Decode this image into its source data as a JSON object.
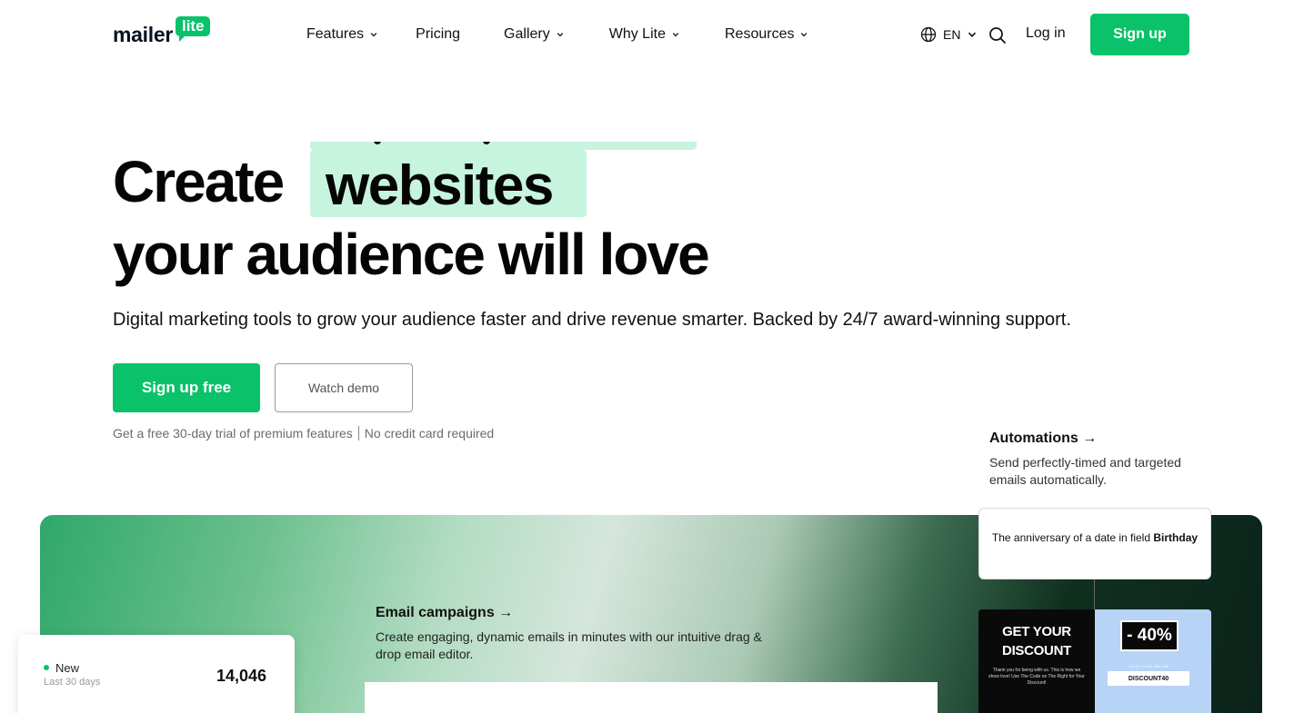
{
  "brand": {
    "word": "mailer",
    "badge": "lite",
    "accent": "#09c269"
  },
  "nav": {
    "items": [
      {
        "label": "Features",
        "has_dropdown": true
      },
      {
        "label": "Pricing",
        "has_dropdown": false
      },
      {
        "label": "Gallery",
        "has_dropdown": true
      },
      {
        "label": "Why Lite",
        "has_dropdown": true
      },
      {
        "label": "Resources",
        "has_dropdown": true
      }
    ],
    "language": "EN",
    "login": "Log in",
    "signup": "Sign up"
  },
  "hero": {
    "title_start": "Create",
    "title_highlight": "websites",
    "title_end": "your audience will love",
    "subtitle": "Digital marketing tools to grow your audience faster and drive revenue smarter. Backed by 24/7 award-winning support.",
    "primary_cta": "Sign up free",
    "secondary_cta": "Watch demo",
    "note_left": "Get a free 30-day trial of premium features",
    "note_right": "No credit card required",
    "highlight_color": "#c7f4de"
  },
  "features": {
    "automations": {
      "title": "Automations →",
      "desc": "Send perfectly-timed and targeted emails automatically."
    },
    "email_campaigns": {
      "title": "Email campaigns →",
      "desc": "Create engaging, dynamic emails in minutes with our intuitive drag & drop email editor."
    }
  },
  "automation_trigger": {
    "text": "The anniversary of a date in field",
    "field": "Birthday"
  },
  "promo_email": {
    "headline_1": "GET YOUR",
    "headline_2": "DISCOUNT",
    "small_text": "Thank you for being with us. This is how we show love! Use The Code on The Right for Your Discount!",
    "percent": "- 40%",
    "code_label": "YOUR CODE BELOW",
    "code": "DISCOUNT40"
  },
  "stat_card": {
    "label": "New",
    "period": "Last 30 days",
    "value": "14,046"
  }
}
